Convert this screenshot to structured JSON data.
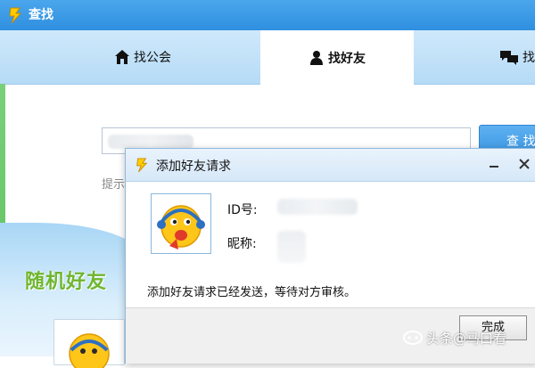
{
  "window": {
    "title": "查找",
    "logo_icon": "qq-logo-icon"
  },
  "tabs": [
    {
      "label": "找公会",
      "icon": "home-icon",
      "active": false
    },
    {
      "label": "找好友",
      "icon": "person-icon",
      "active": true
    },
    {
      "label": "找",
      "icon": "chat-bubbles-icon",
      "active": false
    }
  ],
  "search": {
    "button_label": "查 找",
    "hint_text": "提示"
  },
  "random_friends": {
    "title": "随机好友"
  },
  "dialog": {
    "title": "添加好友请求",
    "id_label": "ID号:",
    "nickname_label": "昵称:",
    "message": "添加好友请求已经发送，等待对方审核。",
    "done_button": "完成",
    "minimize_icon": "minimize-icon",
    "close_icon": "close-icon"
  },
  "watermark": {
    "text": "头条@马口看"
  },
  "colors": {
    "titlebar_blue": "#3b98e5",
    "tabbar_blue": "#c4e2f8",
    "green_title": "#6fb62e",
    "accent_button": "#4aa3ea"
  }
}
